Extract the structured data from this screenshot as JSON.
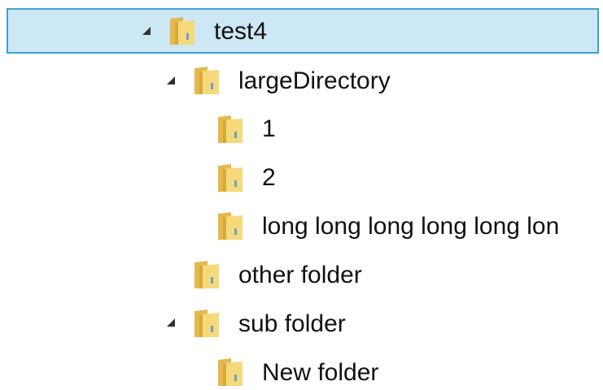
{
  "tree": {
    "items": [
      {
        "label": "test4",
        "depth": 0,
        "expanded": true,
        "selected": true,
        "icon": "folder-icon"
      },
      {
        "label": "largeDirectory",
        "depth": 1,
        "expanded": true,
        "selected": false,
        "icon": "folder-icon"
      },
      {
        "label": "1",
        "depth": 2,
        "expanded": false,
        "selected": false,
        "icon": "folder-icon"
      },
      {
        "label": "2",
        "depth": 2,
        "expanded": false,
        "selected": false,
        "icon": "folder-icon"
      },
      {
        "label": "long long long long long lon",
        "depth": 2,
        "expanded": false,
        "selected": false,
        "icon": "folder-icon"
      },
      {
        "label": "other folder",
        "depth": 1,
        "expanded": false,
        "selected": false,
        "icon": "folder-icon"
      },
      {
        "label": "sub folder",
        "depth": 1,
        "expanded": true,
        "selected": false,
        "icon": "folder-icon"
      },
      {
        "label": "New folder",
        "depth": 2,
        "expanded": false,
        "selected": false,
        "icon": "folder-icon"
      }
    ]
  },
  "colors": {
    "selection_background": "#cce8f4",
    "selection_border": "#3d9fd1",
    "folder_front": "#f5d777",
    "folder_back": "#e4b94a",
    "folder_shadow": "#c79a2c"
  }
}
